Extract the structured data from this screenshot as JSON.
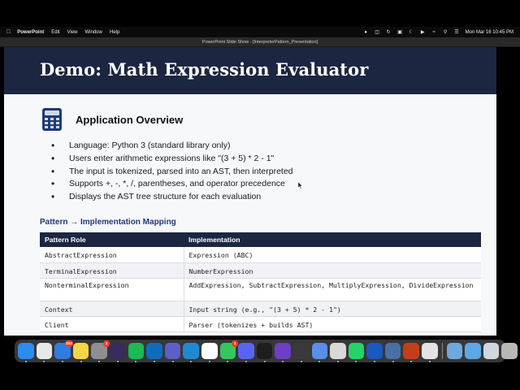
{
  "menubar": {
    "app_name": "PowerPoint",
    "items": [
      "Edit",
      "View",
      "Window",
      "Help"
    ],
    "datetime": "Mon Mar 16  10:45 PM"
  },
  "window": {
    "title": "PowerPoint Slide Show - [InterpreterPattern_Presentation]"
  },
  "slide": {
    "title": "Demo: Math Expression Evaluator",
    "section_title": "Application Overview",
    "section_icon": "calculator-icon",
    "bullets": [
      "Language: Python 3 (standard library only)",
      "Users enter arithmetic expressions like \"(3 + 5) * 2 - 1\"",
      "The input is tokenized, parsed into an AST, then interpreted",
      "Supports +, -, *, /, parentheses, and operator precedence",
      "Displays the AST tree structure for each evaluation"
    ],
    "mapping_title": "Pattern → Implementation Mapping",
    "table": {
      "headers": [
        "Pattern Role",
        "Implementation"
      ],
      "rows": [
        [
          "AbstractExpression",
          "Expression (ABC)"
        ],
        [
          "TerminalExpression",
          "NumberExpression"
        ],
        [
          "NonterminalExpression",
          "AddExpression, SubtractExpression, MultiplyExpression, DivideExpression"
        ],
        [
          "Context",
          "Input string (e.g., \"(3 + 5) * 2 - 1\")"
        ],
        [
          "Client",
          "Parser (tokenizes + builds AST)"
        ]
      ]
    },
    "colors": {
      "header_bg": "#1c2640",
      "accent": "#1f3b73",
      "slide_bg": "#f7f8fa"
    }
  },
  "dock": {
    "apps": [
      {
        "icon": "finder-icon",
        "color": "#2d8cf0"
      },
      {
        "icon": "launchpad-icon",
        "color": "#e8e8e8"
      },
      {
        "icon": "mail-icon",
        "color": "#2f7de1",
        "badge": "204"
      },
      {
        "icon": "notes-icon",
        "color": "#f5d547"
      },
      {
        "icon": "system-settings-icon",
        "color": "#8e8e93",
        "badge": "1"
      },
      {
        "icon": "ai-app-icon",
        "color": "#3b2a5c"
      },
      {
        "icon": "spotify-icon",
        "color": "#1db954"
      },
      {
        "icon": "outlook-icon",
        "color": "#0f6cbd"
      },
      {
        "icon": "teams-icon",
        "color": "#5b5fc7"
      },
      {
        "icon": "vscode-icon",
        "color": "#1f8ad2"
      },
      {
        "icon": "chrome-icon",
        "color": "#ffffff"
      },
      {
        "icon": "messages-icon",
        "color": "#34c759",
        "badge": "1"
      },
      {
        "icon": "discord-icon",
        "color": "#5865f2"
      },
      {
        "icon": "terminal-icon",
        "color": "#1e1e1e"
      },
      {
        "icon": "obsidian-icon",
        "color": "#6c3fc4"
      },
      {
        "icon": "script-app-icon",
        "color": "#3a3a3a"
      },
      {
        "icon": "app-icon",
        "color": "#5a8ee8"
      },
      {
        "icon": "slack-icon",
        "color": "#d8d8d8"
      },
      {
        "icon": "whatsapp-icon",
        "color": "#25d366"
      },
      {
        "icon": "word-icon",
        "color": "#185abd"
      },
      {
        "icon": "disk-utility-icon",
        "color": "#4a6fa5"
      },
      {
        "icon": "powerpoint-icon",
        "color": "#c43e1c"
      },
      {
        "icon": "app-icon-2",
        "color": "#e3e3e3"
      },
      {
        "icon": "preview-icon",
        "color": "#6fa8dc"
      },
      {
        "icon": "folder-icon",
        "color": "#5aa9e6"
      },
      {
        "icon": "downloads-icon",
        "color": "#cfd6de"
      },
      {
        "icon": "trash-icon",
        "color": "#b8b8b8"
      }
    ]
  }
}
